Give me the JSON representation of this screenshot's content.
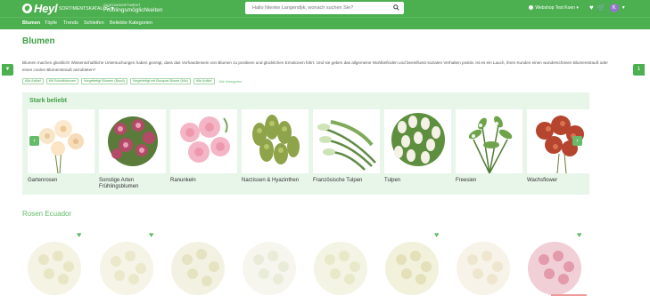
{
  "header": {
    "logo_text": "Heyl",
    "sortiment_label": "SORTIMENTSKATALOG",
    "season_line1": "SAISONSORTIMENT",
    "season_line2": "Frühlingsmöglichkeiten",
    "search_placeholder": "Hallo Nienke Langendijk, wonach suchen Sie?",
    "account_label": "Webshop Test Koen",
    "avatar_letter": "K"
  },
  "nav": {
    "items": [
      "Blumen",
      "Töpfe",
      "Trends",
      "Schleifen",
      "Beliebte Kategorien"
    ]
  },
  "page": {
    "title": "Blumen",
    "description": "Blumen machen glücklich! Wissenschaftliche Untersuchungen haben gezeigt, dass das Vorhandensein von Blumen zu positiven und glücklichen Emotionen führt. Und sie geben das allgemeine Wohlbefinden und beeinflusst sozialen Verhalten positiv. Ist es ein Lauch, ihren Kunden einen wunderschönen Blumenstrauß oder einen coolen Blumenstrauß anzubieten?",
    "chips": [
      "Alle Artikel",
      "Mit Schnittblumen",
      "Vorgefertigt Blumen (Bund)",
      "Vorgefertigt mit Bouquet Blume (Mix)",
      "Alle Artikel"
    ],
    "chips_more": "Alle Kategorien"
  },
  "popular": {
    "heading": "Stark beliebt",
    "items": [
      {
        "label": "Gartenrosen"
      },
      {
        "label": "Sonstige Arten Frühlingsblumen"
      },
      {
        "label": "Ranunkeln"
      },
      {
        "label": "Narzissen & Hyazinthen"
      },
      {
        "label": "Französische Tulpen"
      },
      {
        "label": "Tulpen"
      },
      {
        "label": "Freesien"
      },
      {
        "label": "Wachsflower"
      }
    ]
  },
  "section2": {
    "heading": "Rosen Ecuador"
  },
  "colors": {
    "brand_green": "#4caf50",
    "light_green_bg": "#e8f5e9"
  }
}
